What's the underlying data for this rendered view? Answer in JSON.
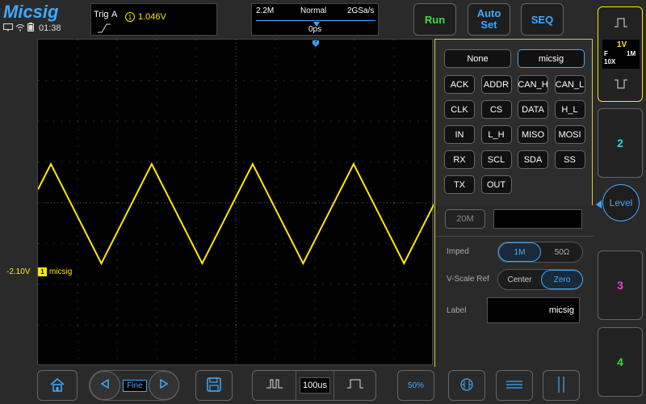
{
  "app": {
    "logo": "Micsig",
    "time": "01:38"
  },
  "trigger": {
    "label": "Trig",
    "source": "A",
    "channel_num": "1",
    "level": "1.046V"
  },
  "timebase": {
    "memory": "2.2M",
    "mode": "Normal",
    "sample_rate": "2GSa/s",
    "position": "0ps",
    "trigger_marker": "T"
  },
  "buttons": {
    "run": "Run",
    "auto_set_1": "Auto",
    "auto_set_2": "Set",
    "seq": "SEQ"
  },
  "channel1": {
    "scale": "1V",
    "coupling": "F",
    "bandwidth": "1M",
    "probe": "10X",
    "offset_label": "-2.10V",
    "marker_num": "1",
    "name": "micsig",
    "color": "#ffe800"
  },
  "label_popup": {
    "none": "None",
    "current": "micsig",
    "options": [
      "ACK",
      "ADDR",
      "CAN_H",
      "CAN_L",
      "CLK",
      "CS",
      "DATA",
      "H_L",
      "IN",
      "L_H",
      "MISO",
      "MOSI",
      "RX",
      "SCL",
      "SDA",
      "SS",
      "TX",
      "OUT"
    ]
  },
  "channel_menu": {
    "bw_limit": "20M",
    "imped_label": "Imped",
    "imped_1m": "1M",
    "imped_50": "50Ω",
    "vscale_label": "V-Scale Ref",
    "vscale_center": "Center",
    "vscale_zero": "Zero",
    "label_label": "Label",
    "label_value": "micsig"
  },
  "right_column": {
    "ch2": "2",
    "level": "Level",
    "ch3": "3",
    "ch4": "4"
  },
  "bottom_bar": {
    "fine": "Fine",
    "time_scale": "100us",
    "percent": "50%"
  },
  "colors": {
    "accent": "#3fa9ff",
    "ch1": "#ffe800",
    "ch2": "#27d8d8",
    "ch3": "#ff3bd8",
    "ch4": "#3cdc3c",
    "popup_border": "#d8c84a"
  },
  "waveform": {
    "type": "triangle",
    "period_divisions": 1.0,
    "peak_volts": 1.0,
    "offset_volts": -2.1
  }
}
